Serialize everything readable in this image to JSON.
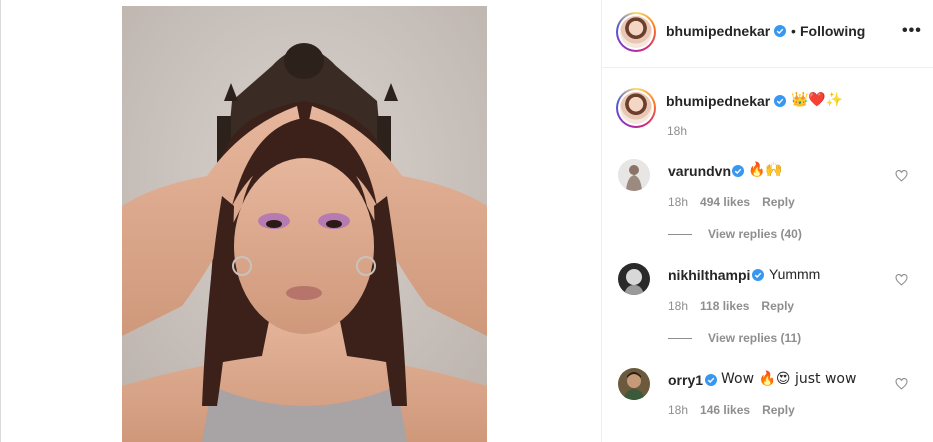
{
  "post": {
    "author": "bhumipednekar",
    "follow_status": "Following",
    "more_glyph": "•••",
    "bullet": "•",
    "caption": {
      "username": "bhumipednekar",
      "text": "👑❤️✨",
      "time": "18h"
    }
  },
  "comments": [
    {
      "username": "varundvn",
      "text": "🔥🙌",
      "time": "18h",
      "likes": "494 likes",
      "reply_label": "Reply",
      "view_replies": "View replies (40)"
    },
    {
      "username": "nikhilthampi",
      "text": "Yummm",
      "time": "18h",
      "likes": "118 likes",
      "reply_label": "Reply",
      "view_replies": "View replies (11)"
    },
    {
      "username": "orry1",
      "text": "Wow 🔥😍 just wow",
      "time": "18h",
      "likes": "146 likes",
      "reply_label": "Reply"
    }
  ],
  "colors": {
    "verified": "#3897f0",
    "text": "#262626",
    "muted": "#8e8e8e",
    "border": "#efefef"
  },
  "icons": {
    "verified": "verified-badge-icon",
    "more": "more-options-icon",
    "like": "heart-outline-icon"
  }
}
